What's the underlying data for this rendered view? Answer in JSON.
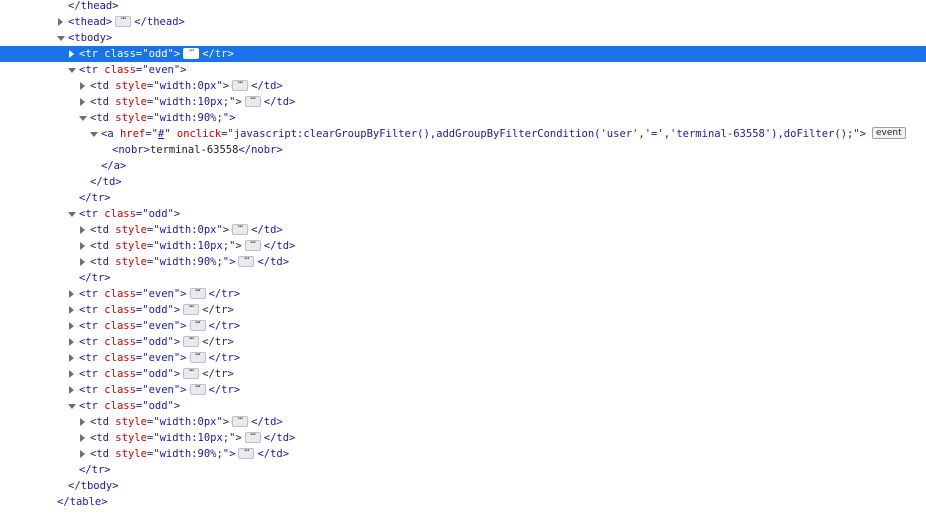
{
  "colors": {
    "tag": "#1a1aa6",
    "attr_name": "#c80000",
    "attr_value": "#1a1aa6",
    "selection": "#1a73e8"
  },
  "icons": {
    "expanded": "triangle-down-icon",
    "collapsed": "triangle-right-icon",
    "ellipsis": "ellipsis-icon"
  },
  "rows": [
    {
      "depth": 0,
      "parts": [
        {
          "k": "tag",
          "t": "</thead>"
        }
      ]
    },
    {
      "depth": 0,
      "twisty": "right",
      "parts": [
        {
          "k": "tag",
          "t": "<thead>"
        },
        {
          "k": "ell",
          "t": "⋯"
        },
        {
          "k": "tag",
          "t": "</thead>"
        }
      ]
    },
    {
      "depth": 0,
      "twisty": "down",
      "parts": [
        {
          "k": "tag",
          "t": "<tbody>"
        }
      ]
    },
    {
      "depth": 1,
      "twisty": "right",
      "selected": true,
      "parts": [
        {
          "k": "tag",
          "t": "<tr "
        },
        {
          "k": "an",
          "t": "class"
        },
        {
          "k": "tag",
          "t": "=\""
        },
        {
          "k": "av",
          "t": "odd"
        },
        {
          "k": "tag",
          "t": "\">"
        },
        {
          "k": "ell",
          "t": "⋯"
        },
        {
          "k": "tag",
          "t": "</tr>"
        }
      ]
    },
    {
      "depth": 1,
      "twisty": "down",
      "parts": [
        {
          "k": "tag",
          "t": "<tr "
        },
        {
          "k": "an",
          "t": "class"
        },
        {
          "k": "tag",
          "t": "=\""
        },
        {
          "k": "av",
          "t": "even"
        },
        {
          "k": "tag",
          "t": "\">"
        }
      ]
    },
    {
      "depth": 2,
      "twisty": "right",
      "parts": [
        {
          "k": "tag",
          "t": "<td "
        },
        {
          "k": "an",
          "t": "style"
        },
        {
          "k": "tag",
          "t": "=\""
        },
        {
          "k": "av",
          "t": "width:0px"
        },
        {
          "k": "tag",
          "t": "\">"
        },
        {
          "k": "ell",
          "t": "⋯"
        },
        {
          "k": "tag",
          "t": "</td>"
        }
      ]
    },
    {
      "depth": 2,
      "twisty": "right",
      "parts": [
        {
          "k": "tag",
          "t": "<td "
        },
        {
          "k": "an",
          "t": "style"
        },
        {
          "k": "tag",
          "t": "=\""
        },
        {
          "k": "av",
          "t": "width:10px;"
        },
        {
          "k": "tag",
          "t": "\">"
        },
        {
          "k": "ell",
          "t": "⋯"
        },
        {
          "k": "tag",
          "t": "</td>"
        }
      ]
    },
    {
      "depth": 2,
      "twisty": "down",
      "parts": [
        {
          "k": "tag",
          "t": "<td "
        },
        {
          "k": "an",
          "t": "style"
        },
        {
          "k": "tag",
          "t": "=\""
        },
        {
          "k": "av",
          "t": "width:90%;"
        },
        {
          "k": "tag",
          "t": "\">"
        }
      ]
    },
    {
      "depth": 3,
      "twisty": "down",
      "parts": [
        {
          "k": "tag",
          "t": "<a "
        },
        {
          "k": "an",
          "t": "href"
        },
        {
          "k": "tag",
          "t": "=\""
        },
        {
          "k": "av",
          "t": "#",
          "link": true
        },
        {
          "k": "tag",
          "t": "\" "
        },
        {
          "k": "an",
          "t": "onclick"
        },
        {
          "k": "tag",
          "t": "=\""
        },
        {
          "k": "av",
          "t": "javascript:clearGroupByFilter(),addGroupByFilterCondition('user','=','terminal-63558'),doFilter();"
        },
        {
          "k": "tag",
          "t": "\">"
        },
        {
          "k": "badge",
          "t": "event"
        }
      ]
    },
    {
      "depth": 4,
      "parts": [
        {
          "k": "tag",
          "t": "<nobr>"
        },
        {
          "k": "txt",
          "t": "terminal-63558"
        },
        {
          "k": "tag",
          "t": "</nobr>"
        }
      ]
    },
    {
      "depth": 3,
      "parts": [
        {
          "k": "tag",
          "t": "</a>"
        }
      ]
    },
    {
      "depth": 2,
      "parts": [
        {
          "k": "tag",
          "t": "</td>"
        }
      ]
    },
    {
      "depth": 1,
      "parts": [
        {
          "k": "tag",
          "t": "</tr>"
        }
      ]
    },
    {
      "depth": 1,
      "twisty": "down",
      "parts": [
        {
          "k": "tag",
          "t": "<tr "
        },
        {
          "k": "an",
          "t": "class"
        },
        {
          "k": "tag",
          "t": "=\""
        },
        {
          "k": "av",
          "t": "odd"
        },
        {
          "k": "tag",
          "t": "\">"
        }
      ]
    },
    {
      "depth": 2,
      "twisty": "right",
      "parts": [
        {
          "k": "tag",
          "t": "<td "
        },
        {
          "k": "an",
          "t": "style"
        },
        {
          "k": "tag",
          "t": "=\""
        },
        {
          "k": "av",
          "t": "width:0px"
        },
        {
          "k": "tag",
          "t": "\">"
        },
        {
          "k": "ell",
          "t": "⋯"
        },
        {
          "k": "tag",
          "t": "</td>"
        }
      ]
    },
    {
      "depth": 2,
      "twisty": "right",
      "parts": [
        {
          "k": "tag",
          "t": "<td "
        },
        {
          "k": "an",
          "t": "style"
        },
        {
          "k": "tag",
          "t": "=\""
        },
        {
          "k": "av",
          "t": "width:10px;"
        },
        {
          "k": "tag",
          "t": "\">"
        },
        {
          "k": "ell",
          "t": "⋯"
        },
        {
          "k": "tag",
          "t": "</td>"
        }
      ]
    },
    {
      "depth": 2,
      "twisty": "right",
      "parts": [
        {
          "k": "tag",
          "t": "<td "
        },
        {
          "k": "an",
          "t": "style"
        },
        {
          "k": "tag",
          "t": "=\""
        },
        {
          "k": "av",
          "t": "width:90%;"
        },
        {
          "k": "tag",
          "t": "\">"
        },
        {
          "k": "ell",
          "t": "⋯"
        },
        {
          "k": "tag",
          "t": "</td>"
        }
      ]
    },
    {
      "depth": 1,
      "parts": [
        {
          "k": "tag",
          "t": "</tr>"
        }
      ]
    },
    {
      "depth": 1,
      "twisty": "right",
      "parts": [
        {
          "k": "tag",
          "t": "<tr "
        },
        {
          "k": "an",
          "t": "class"
        },
        {
          "k": "tag",
          "t": "=\""
        },
        {
          "k": "av",
          "t": "even"
        },
        {
          "k": "tag",
          "t": "\">"
        },
        {
          "k": "ell",
          "t": "⋯"
        },
        {
          "k": "tag",
          "t": "</tr>"
        }
      ]
    },
    {
      "depth": 1,
      "twisty": "right",
      "parts": [
        {
          "k": "tag",
          "t": "<tr "
        },
        {
          "k": "an",
          "t": "class"
        },
        {
          "k": "tag",
          "t": "=\""
        },
        {
          "k": "av",
          "t": "odd"
        },
        {
          "k": "tag",
          "t": "\">"
        },
        {
          "k": "ell",
          "t": "⋯"
        },
        {
          "k": "tag",
          "t": "</tr>"
        }
      ]
    },
    {
      "depth": 1,
      "twisty": "right",
      "parts": [
        {
          "k": "tag",
          "t": "<tr "
        },
        {
          "k": "an",
          "t": "class"
        },
        {
          "k": "tag",
          "t": "=\""
        },
        {
          "k": "av",
          "t": "even"
        },
        {
          "k": "tag",
          "t": "\">"
        },
        {
          "k": "ell",
          "t": "⋯"
        },
        {
          "k": "tag",
          "t": "</tr>"
        }
      ]
    },
    {
      "depth": 1,
      "twisty": "right",
      "parts": [
        {
          "k": "tag",
          "t": "<tr "
        },
        {
          "k": "an",
          "t": "class"
        },
        {
          "k": "tag",
          "t": "=\""
        },
        {
          "k": "av",
          "t": "odd"
        },
        {
          "k": "tag",
          "t": "\">"
        },
        {
          "k": "ell",
          "t": "⋯"
        },
        {
          "k": "tag",
          "t": "</tr>"
        }
      ]
    },
    {
      "depth": 1,
      "twisty": "right",
      "parts": [
        {
          "k": "tag",
          "t": "<tr "
        },
        {
          "k": "an",
          "t": "class"
        },
        {
          "k": "tag",
          "t": "=\""
        },
        {
          "k": "av",
          "t": "even"
        },
        {
          "k": "tag",
          "t": "\">"
        },
        {
          "k": "ell",
          "t": "⋯"
        },
        {
          "k": "tag",
          "t": "</tr>"
        }
      ]
    },
    {
      "depth": 1,
      "twisty": "right",
      "parts": [
        {
          "k": "tag",
          "t": "<tr "
        },
        {
          "k": "an",
          "t": "class"
        },
        {
          "k": "tag",
          "t": "=\""
        },
        {
          "k": "av",
          "t": "odd"
        },
        {
          "k": "tag",
          "t": "\">"
        },
        {
          "k": "ell",
          "t": "⋯"
        },
        {
          "k": "tag",
          "t": "</tr>"
        }
      ]
    },
    {
      "depth": 1,
      "twisty": "right",
      "parts": [
        {
          "k": "tag",
          "t": "<tr "
        },
        {
          "k": "an",
          "t": "class"
        },
        {
          "k": "tag",
          "t": "=\""
        },
        {
          "k": "av",
          "t": "even"
        },
        {
          "k": "tag",
          "t": "\">"
        },
        {
          "k": "ell",
          "t": "⋯"
        },
        {
          "k": "tag",
          "t": "</tr>"
        }
      ]
    },
    {
      "depth": 1,
      "twisty": "down",
      "parts": [
        {
          "k": "tag",
          "t": "<tr "
        },
        {
          "k": "an",
          "t": "class"
        },
        {
          "k": "tag",
          "t": "=\""
        },
        {
          "k": "av",
          "t": "odd"
        },
        {
          "k": "tag",
          "t": "\">"
        }
      ]
    },
    {
      "depth": 2,
      "twisty": "right",
      "parts": [
        {
          "k": "tag",
          "t": "<td "
        },
        {
          "k": "an",
          "t": "style"
        },
        {
          "k": "tag",
          "t": "=\""
        },
        {
          "k": "av",
          "t": "width:0px"
        },
        {
          "k": "tag",
          "t": "\">"
        },
        {
          "k": "ell",
          "t": "⋯"
        },
        {
          "k": "tag",
          "t": "</td>"
        }
      ]
    },
    {
      "depth": 2,
      "twisty": "right",
      "parts": [
        {
          "k": "tag",
          "t": "<td "
        },
        {
          "k": "an",
          "t": "style"
        },
        {
          "k": "tag",
          "t": "=\""
        },
        {
          "k": "av",
          "t": "width:10px;"
        },
        {
          "k": "tag",
          "t": "\">"
        },
        {
          "k": "ell",
          "t": "⋯"
        },
        {
          "k": "tag",
          "t": "</td>"
        }
      ]
    },
    {
      "depth": 2,
      "twisty": "right",
      "parts": [
        {
          "k": "tag",
          "t": "<td "
        },
        {
          "k": "an",
          "t": "style"
        },
        {
          "k": "tag",
          "t": "=\""
        },
        {
          "k": "av",
          "t": "width:90%;"
        },
        {
          "k": "tag",
          "t": "\">"
        },
        {
          "k": "ell",
          "t": "⋯"
        },
        {
          "k": "tag",
          "t": "</td>"
        }
      ]
    },
    {
      "depth": 1,
      "parts": [
        {
          "k": "tag",
          "t": "</tr>"
        }
      ]
    },
    {
      "depth": 0,
      "parts": [
        {
          "k": "tag",
          "t": "</tbody>"
        }
      ]
    },
    {
      "depth": -1,
      "parts": [
        {
          "k": "tag",
          "t": "</table>"
        }
      ]
    }
  ]
}
